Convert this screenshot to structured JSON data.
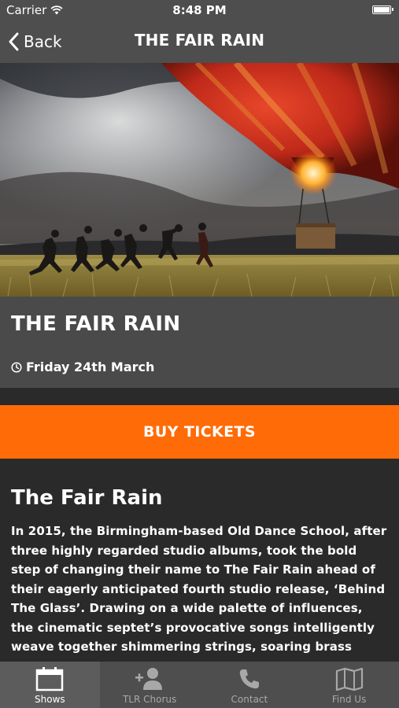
{
  "status_bar": {
    "carrier": "Carrier",
    "time": "8:48 PM",
    "wifi_icon": "wifi-icon",
    "battery_icon": "battery-icon"
  },
  "nav": {
    "back_label": "Back",
    "title": "THE FAIR RAIN"
  },
  "hero": {
    "image_description": "hot-air-balloon-with-running-figures"
  },
  "event": {
    "title": "THE FAIR RAIN",
    "date": "Friday 24th March"
  },
  "buy_button": {
    "label": "BUY TICKETS",
    "color": "#ff6b06"
  },
  "about": {
    "heading": "The Fair Rain",
    "body": "In 2015, the Birmingham-based Old Dance School, after three highly regarded studio albums, took the bold step of changing their name to The Fair Rain ahead of their eagerly anticipated fourth studio release, ‘Behind The Glass’. Drawing on a wide palette of influences, the cinematic septet’s provocative songs intelligently weave together shimmering strings, soaring brass"
  },
  "tabs": [
    {
      "label": "Shows",
      "icon": "calendar-icon",
      "active": true
    },
    {
      "label": "TLR Chorus",
      "icon": "add-user-icon",
      "active": false
    },
    {
      "label": "Contact",
      "icon": "phone-icon",
      "active": false
    },
    {
      "label": "Find Us",
      "icon": "map-icon",
      "active": false
    }
  ],
  "colors": {
    "bar_gray": "#4e4e4e",
    "accent_orange": "#ff6b06",
    "background": "#2a2a2a"
  }
}
